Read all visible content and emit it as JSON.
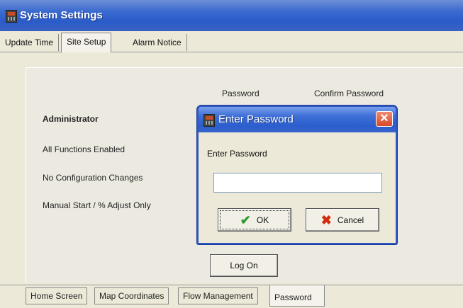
{
  "window": {
    "title": "System Settings",
    "icon": "app-icon"
  },
  "top_tabs": [
    {
      "label": "Update Time",
      "selected": false
    },
    {
      "label": "Site Setup",
      "selected": true
    },
    {
      "label": "Alarm Notice",
      "selected": false
    }
  ],
  "columns": {
    "password": "Password",
    "confirm_password": "Confirm Password"
  },
  "rows": [
    {
      "label": "Administrator",
      "bold": true
    },
    {
      "label": "All Functions Enabled",
      "bold": false
    },
    {
      "label": "No Configuration Changes",
      "bold": false
    },
    {
      "label": "Manual Start / % Adjust Only",
      "bold": false
    }
  ],
  "log_on_button": {
    "label": "Log On"
  },
  "bottom_tabs": [
    {
      "label": "Home Screen",
      "selected": false
    },
    {
      "label": "Map Coordinates",
      "selected": false
    },
    {
      "label": "Flow Management",
      "selected": false
    },
    {
      "label": "Password",
      "selected": true
    }
  ],
  "dialog": {
    "title": "Enter Password",
    "label": "Enter Password",
    "input_value": "",
    "ok_label": "OK",
    "cancel_label": "Cancel",
    "ok_icon": "checkmark-icon",
    "cancel_icon": "x-icon",
    "close_icon": "close-icon"
  },
  "colors": {
    "titlebar": "#2a5bc9",
    "ok_icon": "#2f9a2f",
    "cancel_icon": "#d22a0c",
    "close_button": "#d8472a"
  }
}
